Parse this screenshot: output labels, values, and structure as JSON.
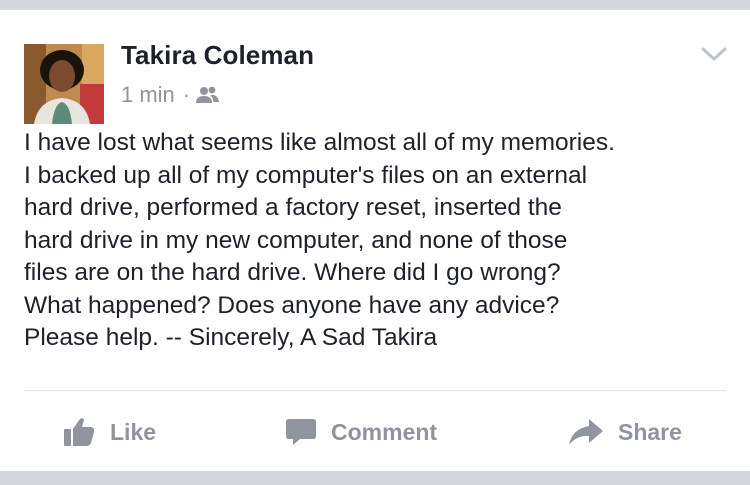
{
  "post": {
    "author_name": "Takira Coleman",
    "timestamp": "1 min",
    "separator": "·",
    "audience_icon": "friends-icon",
    "menu_icon": "chevron-down-icon",
    "text": "I have lost what seems like almost all of my memories.\nI backed up all of my computer's files on an external\nhard drive, performed a factory reset, inserted the\nhard drive in my new computer, and none of those\nfiles are on the hard drive. Where did I go wrong?\nWhat happened? Does anyone have any advice?\nPlease help. -- Sincerely, A Sad Takira"
  },
  "actions": {
    "like_label": "Like",
    "like_icon": "thumbs-up-icon",
    "comment_label": "Comment",
    "comment_icon": "speech-bubble-icon",
    "share_label": "Share",
    "share_icon": "share-arrow-icon"
  },
  "colors": {
    "background": "#d3d6db",
    "card": "#ffffff",
    "text_primary": "#1d2129",
    "text_secondary": "#90949c"
  }
}
